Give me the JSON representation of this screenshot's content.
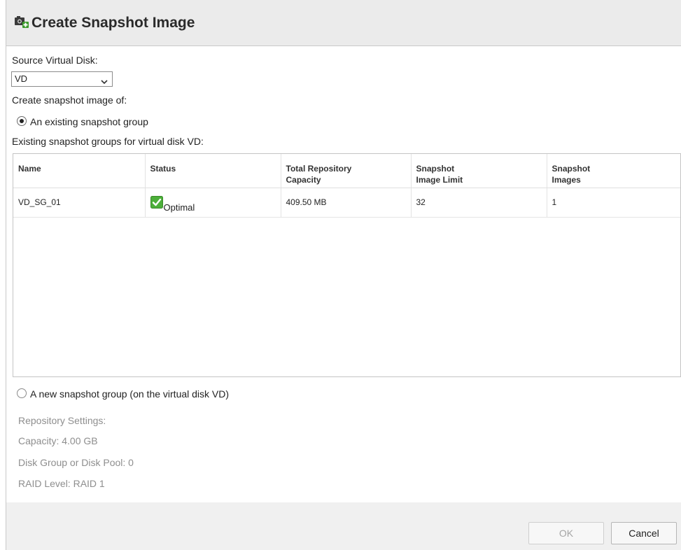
{
  "dialog": {
    "title": "Create Snapshot Image"
  },
  "source": {
    "label": "Source Virtual Disk:",
    "selected": "VD"
  },
  "create_of_label": "Create snapshot image of:",
  "existing_option": {
    "label": "An existing snapshot group",
    "checked": true
  },
  "groups_label": "Existing snapshot groups for virtual disk VD:",
  "table": {
    "headers": {
      "name": "Name",
      "status": "Status",
      "capacity_1": "Total Repository",
      "capacity_2": "Capacity",
      "limit_1": "Snapshot",
      "limit_2": "Image Limit",
      "images_1": "Snapshot",
      "images_2": "Images"
    },
    "rows": [
      {
        "name": "VD_SG_01",
        "status": "Optimal",
        "capacity": "409.50 MB",
        "limit": "32",
        "images": "1"
      }
    ]
  },
  "new_option": {
    "label": "A new snapshot group (on the virtual disk VD)",
    "checked": false
  },
  "repository": {
    "heading": "Repository Settings:",
    "capacity": "Capacity: 4.00 GB",
    "disk_group": "Disk Group or Disk Pool: 0",
    "raid": "RAID Level: RAID 1"
  },
  "buttons": {
    "ok": "OK",
    "cancel": "Cancel"
  },
  "colors": {
    "header_bg": "#ebebeb",
    "footer_bg": "#f0f0f0",
    "status_green": "#4caf3a",
    "disabled_text": "#8e8e8e"
  },
  "icons": {
    "title": "snapshot-camera-add-icon",
    "status": "green-check-icon",
    "dropdown": "chevron-down-icon"
  }
}
